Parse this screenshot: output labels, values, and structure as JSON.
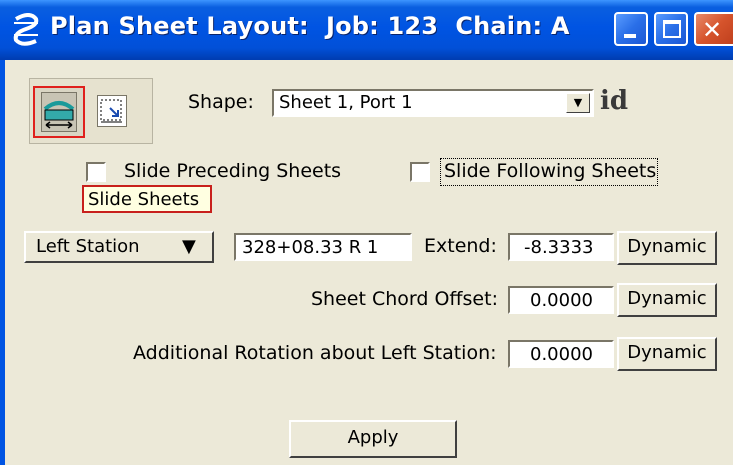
{
  "window": {
    "title": "Plan Sheet Layout:  Job: 123  Chain: A",
    "app_icon": "microstation-s-icon",
    "controls": {
      "minimize": "minimize-icon",
      "maximize": "maximize-icon",
      "close": "close-icon",
      "close_glyph": "✕"
    }
  },
  "tools": {
    "slide_tool_icon": "slide-sheets-icon",
    "place_tool_icon": "place-sheet-icon"
  },
  "shape": {
    "label": "Shape:",
    "value": "Sheet 1, Port 1",
    "arrow": "▼",
    "id_button": "id"
  },
  "options": {
    "slide_preceding": {
      "label": "Slide Preceding Sheets",
      "checked": false
    },
    "slide_following": {
      "label": "Slide Following Sheets",
      "checked": false
    }
  },
  "tooltip": "Slide Sheets",
  "station": {
    "mode": "Left Station",
    "arrow": "▼",
    "value": "328+08.33 R 1",
    "extend_label": "Extend:",
    "extend_value": "-8.3333",
    "dynamic_label": "Dynamic"
  },
  "chord": {
    "label": "Sheet Chord Offset:",
    "value": "0.0000",
    "dynamic_label": "Dynamic"
  },
  "rotation": {
    "label": "Additional Rotation about Left Station:",
    "value": "0.0000",
    "dynamic_label": "Dynamic"
  },
  "apply_label": "Apply",
  "colors": {
    "titlebar": "#0054e3",
    "dialog_bg": "#ece9d8",
    "tooltip_bg": "#ffffe1",
    "tooltip_border": "#c8201c",
    "active_tool_border": "#e0201c"
  }
}
